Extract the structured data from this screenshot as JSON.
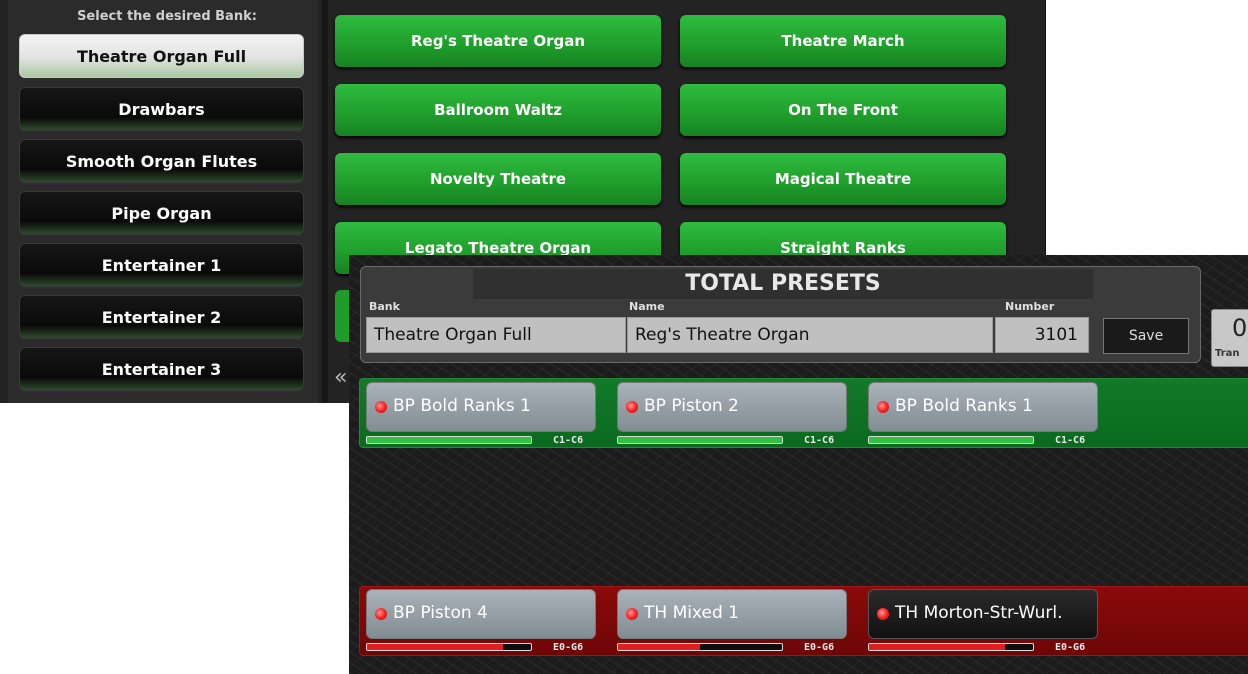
{
  "bank_selector": {
    "heading": "Select the desired Bank:",
    "banks": [
      {
        "label": "Theatre Organ Full",
        "active": true
      },
      {
        "label": "Drawbars"
      },
      {
        "label": "Smooth Organ Flutes"
      },
      {
        "label": "Pipe Organ"
      },
      {
        "label": "Entertainer 1"
      },
      {
        "label": "Entertainer 2"
      },
      {
        "label": "Entertainer 3"
      }
    ],
    "scroll_arrow": "«",
    "presets": [
      "Reg's Theatre Organ",
      "Theatre March",
      "Ballroom Waltz",
      "On The Front",
      "Novelty Theatre",
      "Magical Theatre",
      "Legato Theatre Organ",
      "Straight Ranks"
    ]
  },
  "total_presets": {
    "title": "TOTAL PRESETS",
    "bank_label": "Bank",
    "bank_value": "Theatre Organ Full",
    "name_label": "Name",
    "name_value": "Reg's Theatre Organ",
    "number_label": "Number",
    "number_value": "3101",
    "save_label": "Save",
    "transpose_value": "0",
    "transpose_label": "Tran",
    "upper_zone": {
      "color": "#137a2a",
      "registrations": [
        {
          "label": "BP Bold Ranks 1",
          "range": "C1-C6",
          "level": 1.0
        },
        {
          "label": "BP Piston 2",
          "range": "C1-C6",
          "level": 1.0
        },
        {
          "label": "BP Bold Ranks 1",
          "range": "C1-C6",
          "level": 1.0
        }
      ]
    },
    "lower_zone": {
      "color": "#8b0a0a",
      "registrations": [
        {
          "label": "BP Piston 4",
          "range": "E0-G6",
          "level": 0.83
        },
        {
          "label": "TH Mixed 1",
          "range": "E0-G6",
          "level": 0.5
        },
        {
          "label": "TH Morton-Str-Wurl.",
          "range": "E0-G6",
          "level": 0.83
        }
      ]
    }
  }
}
